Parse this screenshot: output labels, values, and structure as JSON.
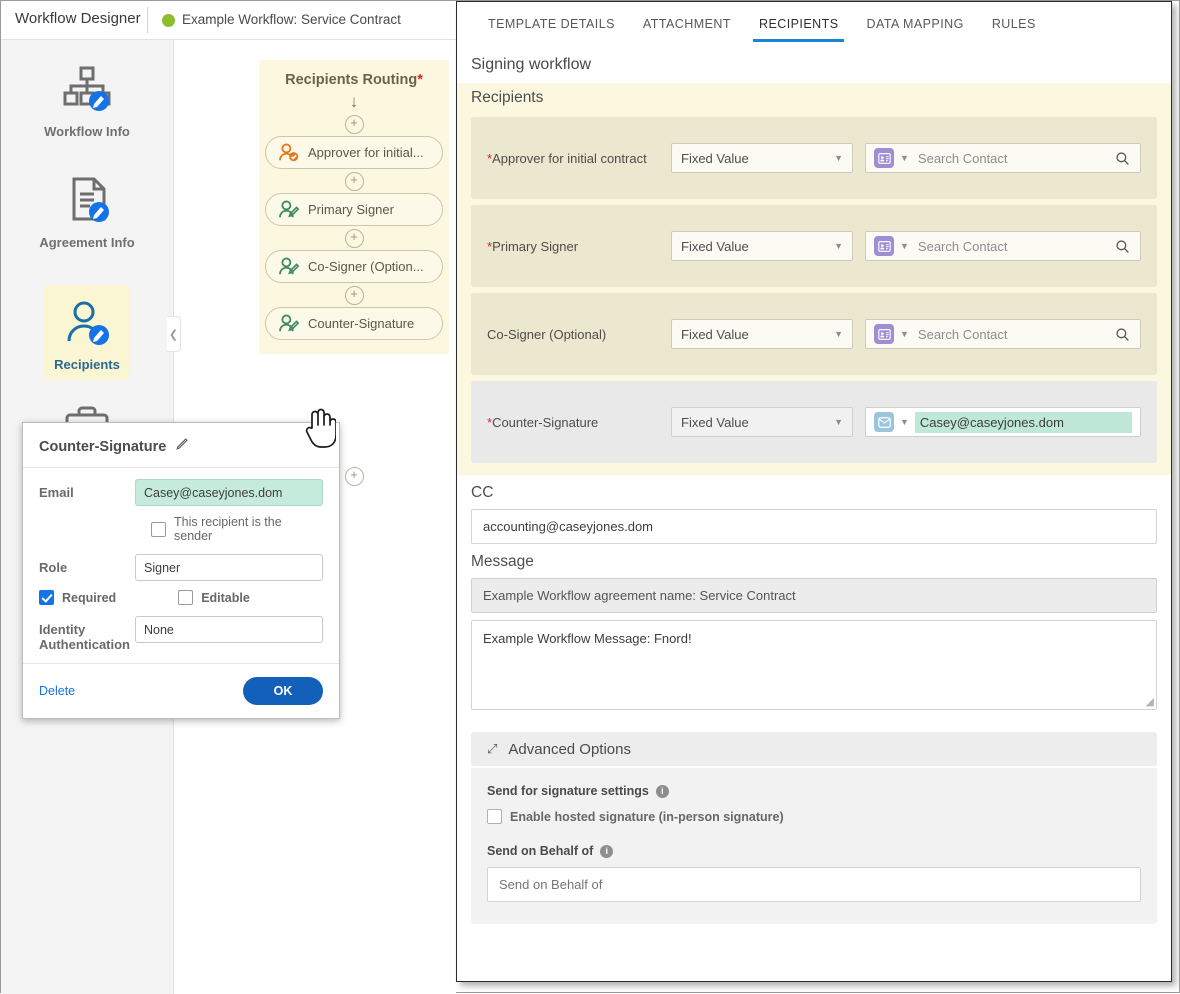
{
  "topbar": {
    "app_title": "Workflow Designer",
    "workflow_name": "Example Workflow: Service Contract",
    "status_dot_color": "#8dbd2f"
  },
  "sidebar": {
    "items": [
      {
        "label": "Workflow Info",
        "icon": "org-chart-edit-icon",
        "active": false
      },
      {
        "label": "Agreement Info",
        "icon": "document-edit-icon",
        "active": false
      },
      {
        "label": "Recipients",
        "icon": "person-edit-icon",
        "active": true
      },
      {
        "label": "",
        "icon": "briefcase-icon",
        "active": false
      }
    ]
  },
  "canvas": {
    "routing_title": "Recipients Routing",
    "routing_required_mark": "*",
    "nodes": [
      {
        "label": "Approver for initial...",
        "icon": "approver-check-icon",
        "color": "#e07b20"
      },
      {
        "label": "Primary Signer",
        "icon": "signer-pen-icon",
        "color": "#3f8a63"
      },
      {
        "label": "Co-Signer (Option...",
        "icon": "signer-pen-icon",
        "color": "#3f8a63"
      },
      {
        "label": "Counter-Signature",
        "icon": "signer-pen-icon",
        "color": "#3f8a63"
      }
    ],
    "add_label": "+"
  },
  "dialog": {
    "title": "Counter-Signature",
    "edit_icon": "pencil-icon",
    "email_label": "Email",
    "email_value": "Casey@caseyjones.dom",
    "sender_checkbox_label": "This recipient is the sender",
    "sender_checked": false,
    "role_label": "Role",
    "role_value": "Signer",
    "required_label": "Required",
    "required_checked": true,
    "editable_label": "Editable",
    "editable_checked": false,
    "identity_label": "Identity Authentication",
    "identity_value": "None",
    "delete_label": "Delete",
    "ok_label": "OK"
  },
  "panel": {
    "tabs": [
      {
        "label": "TEMPLATE DETAILS",
        "active": false
      },
      {
        "label": "ATTACHMENT",
        "active": false
      },
      {
        "label": "RECIPIENTS",
        "active": true
      },
      {
        "label": "DATA MAPPING",
        "active": false
      },
      {
        "label": "RULES",
        "active": false
      }
    ],
    "heading": "Signing workflow",
    "recipients_title": "Recipients",
    "recipients": [
      {
        "required": "*",
        "label": "Approver for initial contract",
        "source": "Fixed Value",
        "icon": "contact-card-icon",
        "value": "",
        "placeholder": "Search Contact",
        "search_icon": "magnifier-icon"
      },
      {
        "required": "*",
        "label": "Primary Signer",
        "source": "Fixed Value",
        "icon": "contact-card-icon",
        "value": "",
        "placeholder": "Search Contact",
        "search_icon": "magnifier-icon"
      },
      {
        "required": "",
        "label": "Co-Signer (Optional)",
        "source": "Fixed Value",
        "icon": "contact-card-icon",
        "value": "",
        "placeholder": "Search Contact",
        "search_icon": "magnifier-icon"
      },
      {
        "required": "*",
        "label": "Counter-Signature",
        "source": "Fixed Value",
        "icon": "envelope-icon",
        "value": "Casey@caseyjones.dom",
        "placeholder": "",
        "search_icon": ""
      }
    ],
    "cc_title": "CC",
    "cc_value": "accounting@caseyjones.dom",
    "message_title": "Message",
    "agreement_name": "Example Workflow agreement name: Service Contract",
    "message_body": "Example Workflow Message: Fnord!",
    "advanced_title": "Advanced Options",
    "advanced": {
      "signature_settings_label": "Send for signature settings",
      "hosted_signature_label": "Enable hosted signature (in-person signature)",
      "hosted_signature_checked": false,
      "send_on_behalf_label": "Send on Behalf of",
      "send_on_behalf_placeholder": "Send on Behalf of",
      "send_on_behalf_value": ""
    }
  }
}
